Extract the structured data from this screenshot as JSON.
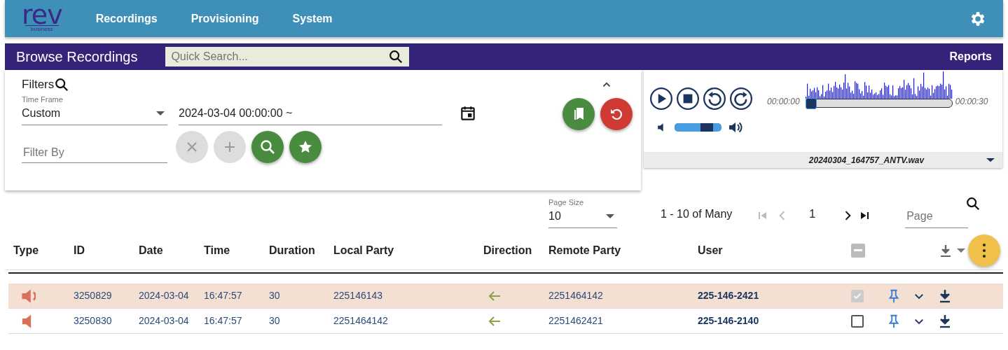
{
  "nav": {
    "logo": "rev",
    "logo_tagline": "business",
    "items": [
      {
        "label": "Recordings"
      },
      {
        "label": "Provisioning"
      },
      {
        "label": "System"
      }
    ]
  },
  "browse": {
    "title": "Browse Recordings",
    "search_placeholder": "Quick Search...",
    "reports": "Reports"
  },
  "filters": {
    "title": "Filters",
    "time_frame_label": "Time Frame",
    "time_frame": "Custom",
    "date_range": "2024-03-04 00:00:00 ~",
    "filter_by_placeholder": "Filter By"
  },
  "player": {
    "start_time": "00:00:00",
    "end_time": "00:00:30",
    "level": 0,
    "volume": {
      "level": 0.82
    },
    "filename": "20240304_164757_ANTV.wav"
  },
  "pagination": {
    "page_size_label": "Page Size",
    "page_size": "10",
    "range": "1 - 10 of Many",
    "current_page": "1",
    "page_placeholder": "Page"
  },
  "table": {
    "columns": [
      "Type",
      "ID",
      "Date",
      "Time",
      "Duration",
      "Local Party",
      "Direction",
      "Remote Party",
      "User"
    ],
    "header_checkbox": {
      "indeterminate": true
    },
    "rows": [
      {
        "id": "3250829",
        "date": "2024-03-04",
        "time": "16:47:57",
        "duration": "30",
        "local_party": "225146143",
        "remote_party": "2251464142",
        "user": "225-146-2421",
        "selected": true,
        "checked": true
      },
      {
        "id": "3250830",
        "date": "2024-03-04",
        "time": "16:47:57",
        "duration": "30",
        "local_party": "2251464142",
        "remote_party": "2251462421",
        "user": "225-146-2140",
        "selected": false,
        "checked": false
      }
    ]
  }
}
